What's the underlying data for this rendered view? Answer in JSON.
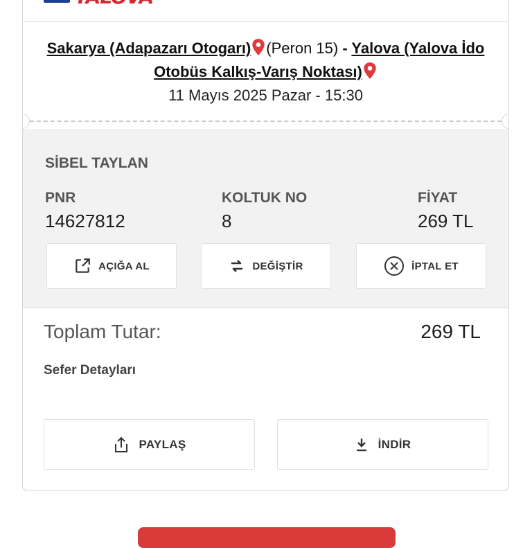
{
  "brand": {
    "logo_text": "YALOVA",
    "accent": "#d6282e",
    "brand_blue": "#1e3f94"
  },
  "trip": {
    "origin": "Sakarya (Adapazarı Otogarı)",
    "platform": "(Peron 15)",
    "separator": " - ",
    "destination": "Yalova (Yalova İdo Otobüs Kalkış-Varış Noktası)",
    "datetime": "11 Mayıs 2025 Pazar - 15:30"
  },
  "passenger": {
    "name": "SİBEL TAYLAN",
    "pnr_label": "PNR",
    "pnr": "14627812",
    "seat_label": "KOLTUK NO",
    "seat": "8",
    "price_label": "FİYAT",
    "price": "269 TL"
  },
  "actions": {
    "open": "AÇIĞA AL",
    "change": "DEĞİŞTİR",
    "cancel": "İPTAL ET"
  },
  "summary": {
    "total_label": "Toplam Tutar:",
    "total_value": "269 TL",
    "details_link": "Sefer Detayları"
  },
  "footer_actions": {
    "share": "PAYLAŞ",
    "download": "İNDİR"
  },
  "icons": {
    "location": "location-pin-icon",
    "open": "open-external-icon",
    "change": "swap-arrows-icon",
    "cancel": "close-circle-icon",
    "share": "share-icon",
    "download": "download-icon"
  },
  "colors": {
    "pin": "#e0393e",
    "panel_bg": "#f2f2f2",
    "cta": "#d93a3a"
  }
}
